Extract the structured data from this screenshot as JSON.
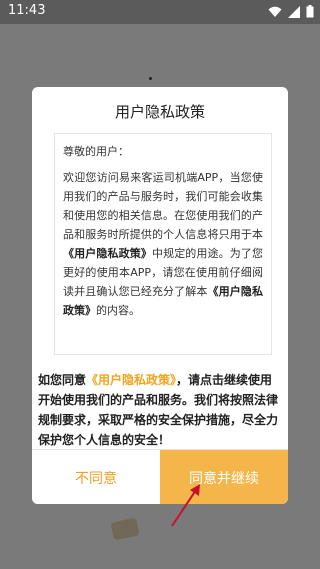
{
  "status_bar": {
    "time": "11:43"
  },
  "dialog": {
    "title": "用户隐私政策",
    "greeting": "尊敬的用户：",
    "body_part1": "欢迎您访问易来客运司机端APP，当您使用我们的产品与服务时，我们可能会收集和使用您的相关信息。在您使用我们的产品和服务时所提供的个人信息将只用于本",
    "body_policy_name": "《用户隐私政策》",
    "body_part2": "中规定的用途。为了您更好的使用本APP，请您在使用前仔细阅读并且确认您已经充分了解本",
    "body_policy_name2": "《用户隐私政策》",
    "body_part3": "的内容。",
    "notice_prefix": "如您同意",
    "notice_link": "《用户隐私政策》",
    "notice_suffix": "，请点击继续使用开始使用我们的产品和服务。我们将按照法律规制要求，采取严格的安全保护措施，尽全力保护您个人信息的安全！",
    "disagree_label": "不同意",
    "agree_label": "同意并继续"
  },
  "colors": {
    "accent": "#f4b54a",
    "link": "#f2a51c",
    "arrow": "#c8102e"
  }
}
